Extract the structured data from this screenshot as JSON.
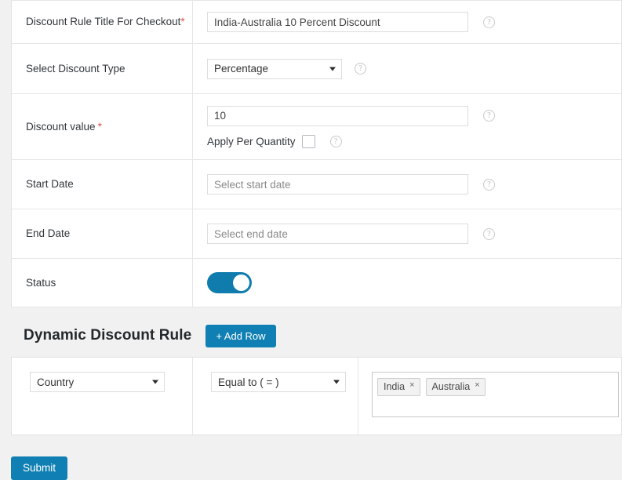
{
  "form": {
    "rows": [
      {
        "label": "Discount Rule Title For Checkout",
        "required_mark": "*",
        "value": "India-Australia 10 Percent Discount",
        "help": "?"
      },
      {
        "label": "Select Discount Type",
        "selected": "Percentage",
        "help": "?"
      },
      {
        "label": "Discount value",
        "required_mark": "*",
        "value": "10",
        "help": "?",
        "checkbox_label": "Apply Per Quantity",
        "checkbox_help": "?"
      },
      {
        "label": "Start Date",
        "placeholder": "Select start date",
        "help": "?"
      },
      {
        "label": "End Date",
        "placeholder": "Select end date",
        "help": "?"
      },
      {
        "label": "Status",
        "toggle_on": true
      }
    ]
  },
  "dynamic_section": {
    "title": "Dynamic Discount Rule",
    "add_row_label": "+ Add Row",
    "rule": {
      "field": "Country",
      "operator": "Equal to ( = )",
      "tags": [
        {
          "label": "India",
          "remove": "×"
        },
        {
          "label": "Australia",
          "remove": "×"
        }
      ]
    }
  },
  "footer": {
    "submit_label": "Submit"
  },
  "colors": {
    "accent": "#1080b4",
    "toggle_on": "#0f7cad",
    "required": "#d9534f",
    "page_bg": "#f1f1f1"
  }
}
